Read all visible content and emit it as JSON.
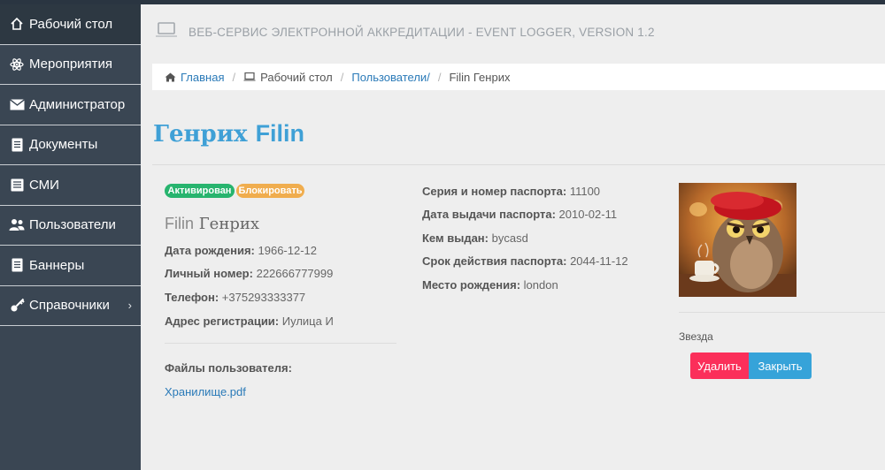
{
  "sidebar": {
    "items": [
      {
        "label": "Рабочий стол",
        "icon": "home-icon",
        "active": true
      },
      {
        "label": "Мероприятия",
        "icon": "atom-icon"
      },
      {
        "label": "Администратор",
        "icon": "envelope-icon"
      },
      {
        "label": "Документы",
        "icon": "document-icon"
      },
      {
        "label": "СМИ",
        "icon": "newspaper-icon"
      },
      {
        "label": "Пользователи",
        "icon": "users-icon"
      },
      {
        "label": "Баннеры",
        "icon": "list-icon"
      },
      {
        "label": "Справочники",
        "icon": "key-icon",
        "chevron": "›"
      }
    ]
  },
  "header": {
    "title": "ВЕБ-СЕРВИС ЭЛЕКТРОННОЙ АККРЕДИТАЦИИ - EVENT LOGGER, VERSION 1.2",
    "icon": "laptop-icon"
  },
  "breadcrumb": {
    "home": "Главная",
    "desktop": "Рабочий стол",
    "users": "Пользователи/",
    "current": "Filin Генрих",
    "sep": "/"
  },
  "profile": {
    "title_first": "Генрих",
    "title_last": "Filin",
    "badge_status": "Активирован",
    "badge_block": "Блокировать",
    "name_first": "Filin",
    "name_last": "Генрих",
    "birth_label": "Дата рождения:",
    "birth_value": "1966-12-12",
    "personal_label": "Личный номер:",
    "personal_value": "222666777999",
    "phone_label": "Телефон:",
    "phone_value": "+375293333377",
    "address_label": "Адрес регистрации:",
    "address_value": "Иулица И",
    "files_label": "Файлы пользователя:",
    "file_name": "Хранилище.pdf",
    "passport_label": "Серия и номер паспорта:",
    "passport_value": "11100",
    "issue_date_label": "Дата выдачи паспорта:",
    "issue_date_value": "2010-02-11",
    "issued_by_label": "Кем выдан:",
    "issued_by_value": "bycasd",
    "expiry_label": "Срок действия паспорта:",
    "expiry_value": "2044-11-12",
    "birthplace_label": "Место рождения:",
    "birthplace_value": "london",
    "photo_caption": "Звезда",
    "delete_label": "Удалить",
    "close_label": "Закрыть"
  },
  "colors": {
    "sidebar": "#3a4653",
    "accent_blue": "#3fa0d6",
    "badge_green": "#27b46e",
    "badge_orange": "#f0ad4e",
    "btn_red": "#fb2f5a",
    "btn_blue": "#36a3d9"
  }
}
